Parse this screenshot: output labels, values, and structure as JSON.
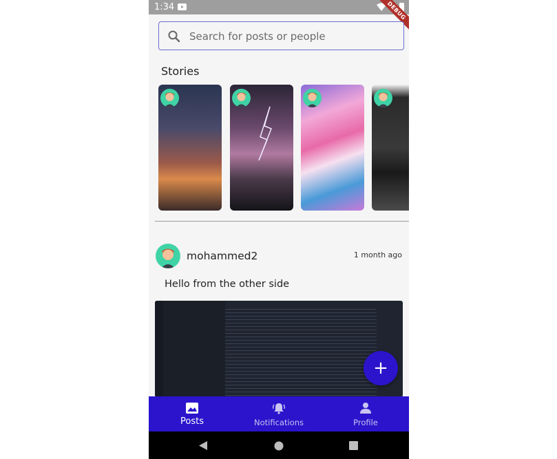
{
  "status_bar": {
    "time": "1:34",
    "debug_label": "DEBUG"
  },
  "search": {
    "placeholder": "Search for posts or people"
  },
  "stories": {
    "title": "Stories"
  },
  "post": {
    "username": "mohammed2",
    "time": "1 month ago",
    "text": "Hello from the other side"
  },
  "fab": {
    "label": "+"
  },
  "bottom_nav": {
    "items": [
      {
        "label": "Posts",
        "icon": "image-icon",
        "active": true
      },
      {
        "label": "Notifications",
        "icon": "bell-icon",
        "active": false
      },
      {
        "label": "Profile",
        "icon": "person-icon",
        "active": false
      }
    ]
  },
  "colors": {
    "accent": "#2b14cc",
    "avatar_bg": "#3fd3a6",
    "search_border": "#6b6bd6",
    "debug_banner": "#b0302a"
  }
}
